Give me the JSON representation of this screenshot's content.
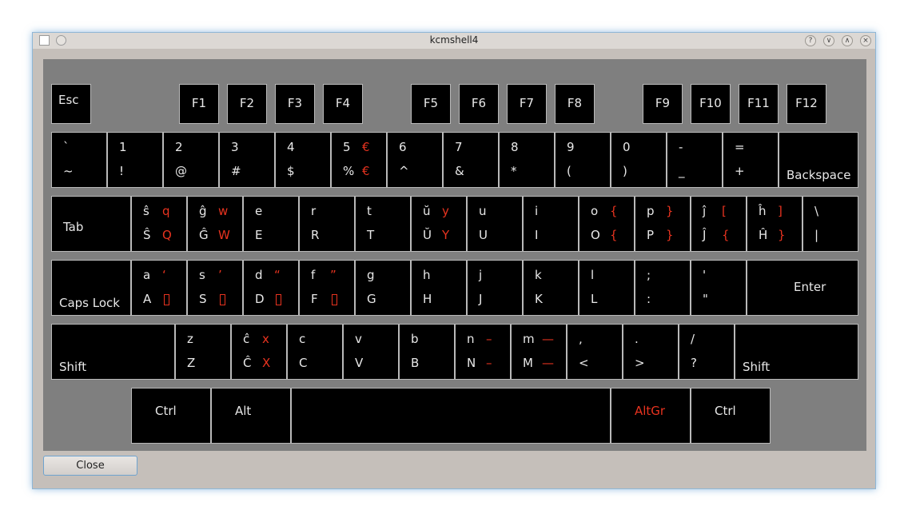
{
  "window": {
    "title": "kcmshell4",
    "controls": [
      "?",
      "∨",
      "∧",
      "×"
    ]
  },
  "keyboard": {
    "fn_row": [
      "Esc",
      "F1",
      "F2",
      "F3",
      "F4",
      "F5",
      "F6",
      "F7",
      "F8",
      "F9",
      "F10",
      "F11",
      "F12"
    ],
    "number_row": [
      {
        "top": "`",
        "bottom": "~"
      },
      {
        "top": "1",
        "bottom": "!"
      },
      {
        "top": "2",
        "bottom": "@"
      },
      {
        "top": "3",
        "bottom": "#"
      },
      {
        "top": "4",
        "bottom": "$"
      },
      {
        "top": "5",
        "bottom": "%",
        "top_alt": "€",
        "bottom_alt": "€"
      },
      {
        "top": "6",
        "bottom": "^"
      },
      {
        "top": "7",
        "bottom": "&"
      },
      {
        "top": "8",
        "bottom": "*"
      },
      {
        "top": "9",
        "bottom": "("
      },
      {
        "top": "0",
        "bottom": ")"
      },
      {
        "top": "-",
        "bottom": "_"
      },
      {
        "top": "=",
        "bottom": "+"
      }
    ],
    "backspace_label": "Backspace",
    "tab_label": "Tab",
    "qwerty_row": [
      {
        "top": "ŝ",
        "bottom": "Ŝ",
        "top_alt": "q",
        "bottom_alt": "Q"
      },
      {
        "top": "ĝ",
        "bottom": "Ĝ",
        "top_alt": "w",
        "bottom_alt": "W"
      },
      {
        "top": "e",
        "bottom": "E"
      },
      {
        "top": "r",
        "bottom": "R"
      },
      {
        "top": "t",
        "bottom": "T"
      },
      {
        "top": "ŭ",
        "bottom": "Ŭ",
        "top_alt": "y",
        "bottom_alt": "Y"
      },
      {
        "top": "u",
        "bottom": "U"
      },
      {
        "top": "i",
        "bottom": "I"
      },
      {
        "top": "o",
        "bottom": "O",
        "top_alt": "{",
        "bottom_alt": "{"
      },
      {
        "top": "p",
        "bottom": "P",
        "top_alt": "}",
        "bottom_alt": "}"
      },
      {
        "top": "ĵ",
        "bottom": "Ĵ",
        "top_alt": "[",
        "bottom_alt": "{"
      },
      {
        "top": "ĥ",
        "bottom": "Ĥ",
        "top_alt": "]",
        "bottom_alt": "}"
      },
      {
        "top": "\\",
        "bottom": "|"
      }
    ],
    "capslock_label": "Caps Lock",
    "home_row": [
      {
        "top": "a",
        "bottom": "A",
        "top_alt": "‘",
        "bottom_alt": "▯"
      },
      {
        "top": "s",
        "bottom": "S",
        "top_alt": "’",
        "bottom_alt": "▯"
      },
      {
        "top": "d",
        "bottom": "D",
        "top_alt": "“",
        "bottom_alt": "▯"
      },
      {
        "top": "f",
        "bottom": "F",
        "top_alt": "”",
        "bottom_alt": "▯"
      },
      {
        "top": "g",
        "bottom": "G"
      },
      {
        "top": "h",
        "bottom": "H"
      },
      {
        "top": "j",
        "bottom": "J"
      },
      {
        "top": "k",
        "bottom": "K"
      },
      {
        "top": "l",
        "bottom": "L"
      },
      {
        "top": ";",
        "bottom": ":"
      },
      {
        "top": "'",
        "bottom": "\""
      }
    ],
    "enter_label": "Enter",
    "shift_label": "Shift",
    "bottom_letter_row": [
      {
        "top": "z",
        "bottom": "Z"
      },
      {
        "top": "ĉ",
        "bottom": "Ĉ",
        "top_alt": "x",
        "bottom_alt": "X"
      },
      {
        "top": "c",
        "bottom": "C"
      },
      {
        "top": "v",
        "bottom": "V"
      },
      {
        "top": "b",
        "bottom": "B"
      },
      {
        "top": "n",
        "bottom": "N",
        "top_alt": "–",
        "bottom_alt": "–"
      },
      {
        "top": "m",
        "bottom": "M",
        "top_alt": "—",
        "bottom_alt": "—"
      },
      {
        "top": ",",
        "bottom": "<"
      },
      {
        "top": ".",
        "bottom": ">"
      },
      {
        "top": "/",
        "bottom": "?"
      }
    ],
    "ctrl_label": "Ctrl",
    "alt_label": "Alt",
    "altgr_label": "AltGr",
    "space_label": ""
  },
  "close_button": "Close",
  "colors": {
    "key_background": "#000000",
    "key_text": "#e8e8e8",
    "alt_symbol": "#e8331f",
    "keyboard_panel": "#7f7f7f",
    "window_background": "#c5bfba"
  }
}
